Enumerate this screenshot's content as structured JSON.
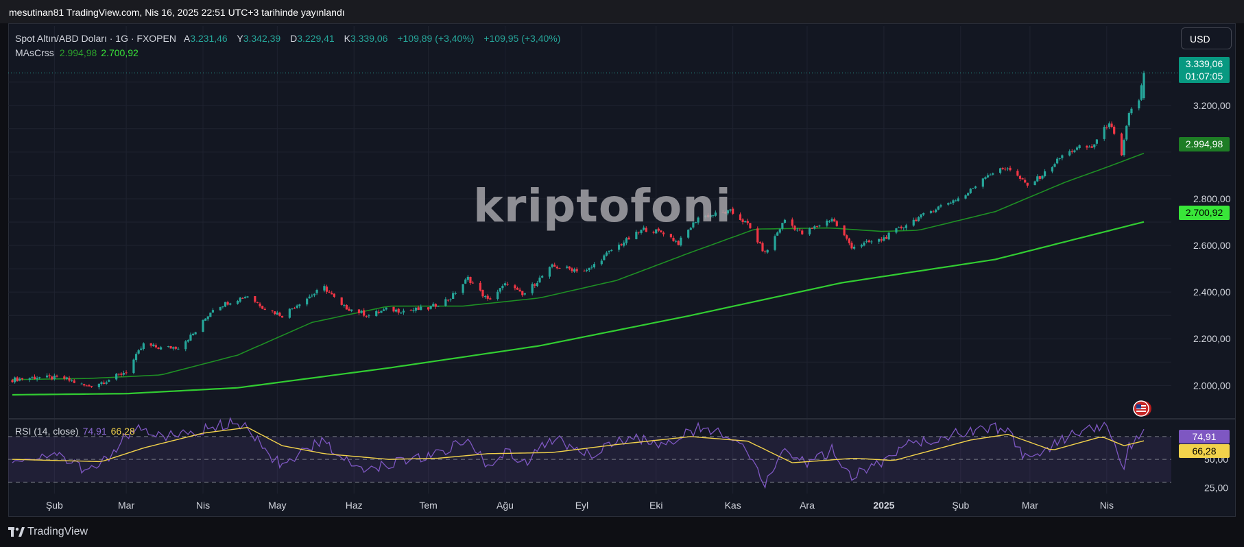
{
  "header": {
    "publish_line": "mesutinan81 TradingView.com, Nis 16, 2025 22:51 UTC+3 tarihinde yayınlandı"
  },
  "legend": {
    "symbol": "Spot Altın/ABD Doları · 1G · FXOPEN",
    "open_key": "A",
    "open": "3.231,46",
    "high_key": "Y",
    "high": "3.342,39",
    "low_key": "D",
    "low": "3.229,41",
    "close_key": "K",
    "close": "3.339,06",
    "change1": "+109,89 (+3,40%)",
    "change2": "+109,95 (+3,40%)",
    "ma_name": "MAsCrss",
    "ma_fast": "2.994,98",
    "ma_slow": "2.700,92"
  },
  "rsi_legend": {
    "name": "RSI (14, close)",
    "rsi": "74,91",
    "ma": "66,28"
  },
  "currency": "USD",
  "tags": {
    "last_price": "3.339,06",
    "countdown": "01:07:05",
    "ma_fast": "2.994,98",
    "ma_slow": "2.700,92",
    "rsi": "74,91",
    "rsi_ma": "66,28"
  },
  "watermark": "kriptofoni",
  "footer": {
    "brand": "TradingView"
  },
  "colors": {
    "up": "#26a69a",
    "down": "#f23645",
    "ma_fast": "#1e8f24",
    "ma_slow": "#32cd32",
    "rsi": "#7e57c2",
    "rsi_ma": "#f2d24b",
    "background": "#131722",
    "grid": "#1f2330"
  },
  "icons": {
    "flag": "us-flag-icon",
    "logo": "tradingview-logo-icon"
  },
  "chart_data": {
    "type": "candlestick",
    "title": "Spot Altın/ABD Doları · 1G · FXOPEN",
    "x_range": [
      "2024-01-15",
      "2025-04-16"
    ],
    "y_ticks": [
      "2.000,00",
      "2.200,00",
      "2.400,00",
      "2.600,00",
      "2.800,00",
      "3.200,00"
    ],
    "y_tick_values": [
      2000,
      2200,
      2400,
      2600,
      2800,
      3200
    ],
    "ylim": [
      1860,
      3540
    ],
    "x_ticks": [
      {
        "label": "Şub",
        "date": "2024-02-01"
      },
      {
        "label": "Mar",
        "date": "2024-03-01"
      },
      {
        "label": "Nis",
        "date": "2024-04-01"
      },
      {
        "label": "May",
        "date": "2024-05-01"
      },
      {
        "label": "Haz",
        "date": "2024-06-01"
      },
      {
        "label": "Tem",
        "date": "2024-07-01"
      },
      {
        "label": "Ağu",
        "date": "2024-08-01"
      },
      {
        "label": "Eyl",
        "date": "2024-09-01"
      },
      {
        "label": "Eki",
        "date": "2024-10-01"
      },
      {
        "label": "Kas",
        "date": "2024-11-01"
      },
      {
        "label": "Ara",
        "date": "2024-12-01"
      },
      {
        "label": "2025",
        "date": "2025-01-01"
      },
      {
        "label": "Şub",
        "date": "2025-02-01"
      },
      {
        "label": "Mar",
        "date": "2025-03-01"
      },
      {
        "label": "Nis",
        "date": "2025-04-01"
      }
    ],
    "price_path": [
      [
        "2024-01-15",
        2025
      ],
      [
        "2024-01-25",
        2035
      ],
      [
        "2024-02-05",
        2030
      ],
      [
        "2024-02-14",
        1995
      ],
      [
        "2024-02-22",
        2020
      ],
      [
        "2024-03-01",
        2060
      ],
      [
        "2024-03-08",
        2175
      ],
      [
        "2024-03-15",
        2160
      ],
      [
        "2024-03-22",
        2165
      ],
      [
        "2024-03-29",
        2230
      ],
      [
        "2024-04-05",
        2330
      ],
      [
        "2024-04-12",
        2360
      ],
      [
        "2024-04-19",
        2385
      ],
      [
        "2024-04-26",
        2330
      ],
      [
        "2024-05-03",
        2300
      ],
      [
        "2024-05-10",
        2355
      ],
      [
        "2024-05-20",
        2420
      ],
      [
        "2024-05-27",
        2340
      ],
      [
        "2024-06-07",
        2300
      ],
      [
        "2024-06-14",
        2325
      ],
      [
        "2024-06-21",
        2320
      ],
      [
        "2024-07-01",
        2330
      ],
      [
        "2024-07-10",
        2375
      ],
      [
        "2024-07-17",
        2460
      ],
      [
        "2024-07-25",
        2365
      ],
      [
        "2024-08-02",
        2440
      ],
      [
        "2024-08-08",
        2385
      ],
      [
        "2024-08-20",
        2510
      ],
      [
        "2024-09-03",
        2490
      ],
      [
        "2024-09-13",
        2580
      ],
      [
        "2024-09-26",
        2670
      ],
      [
        "2024-10-04",
        2655
      ],
      [
        "2024-10-10",
        2610
      ],
      [
        "2024-10-18",
        2720
      ],
      [
        "2024-10-31",
        2745
      ],
      [
        "2024-11-07",
        2690
      ],
      [
        "2024-11-14",
        2565
      ],
      [
        "2024-11-22",
        2710
      ],
      [
        "2024-11-29",
        2650
      ],
      [
        "2024-12-11",
        2715
      ],
      [
        "2024-12-19",
        2595
      ],
      [
        "2024-12-31",
        2625
      ],
      [
        "2025-01-10",
        2690
      ],
      [
        "2025-01-24",
        2770
      ],
      [
        "2025-02-03",
        2815
      ],
      [
        "2025-02-11",
        2900
      ],
      [
        "2025-02-20",
        2935
      ],
      [
        "2025-02-28",
        2855
      ],
      [
        "2025-03-07",
        2910
      ],
      [
        "2025-03-14",
        2985
      ],
      [
        "2025-03-21",
        3020
      ],
      [
        "2025-03-26",
        3020
      ],
      [
        "2025-04-02",
        3130
      ],
      [
        "2025-04-07",
        2980
      ],
      [
        "2025-04-10",
        3170
      ],
      [
        "2025-04-14",
        3225
      ],
      [
        "2025-04-16",
        3339
      ]
    ],
    "series": [
      {
        "name": "MAsCrss 50",
        "color": "#1e8f24",
        "points": [
          [
            "2024-01-15",
            2025
          ],
          [
            "2024-02-15",
            2030
          ],
          [
            "2024-03-15",
            2045
          ],
          [
            "2024-04-15",
            2130
          ],
          [
            "2024-05-15",
            2270
          ],
          [
            "2024-06-15",
            2340
          ],
          [
            "2024-07-15",
            2340
          ],
          [
            "2024-08-15",
            2375
          ],
          [
            "2024-09-15",
            2450
          ],
          [
            "2024-10-15",
            2570
          ],
          [
            "2024-11-10",
            2670
          ],
          [
            "2024-12-10",
            2675
          ],
          [
            "2024-12-31",
            2660
          ],
          [
            "2025-01-15",
            2665
          ],
          [
            "2025-02-15",
            2745
          ],
          [
            "2025-03-15",
            2870
          ],
          [
            "2025-04-01",
            2935
          ],
          [
            "2025-04-16",
            2995
          ]
        ]
      },
      {
        "name": "MAsCrss 200",
        "color": "#32cd32",
        "points": [
          [
            "2024-01-15",
            1960
          ],
          [
            "2024-03-01",
            1965
          ],
          [
            "2024-04-15",
            1990
          ],
          [
            "2024-06-15",
            2075
          ],
          [
            "2024-08-15",
            2170
          ],
          [
            "2024-10-15",
            2300
          ],
          [
            "2024-12-15",
            2440
          ],
          [
            "2025-02-15",
            2540
          ],
          [
            "2025-04-16",
            2701
          ]
        ]
      }
    ],
    "last_close": 3339.06,
    "ma_fast_last": 2994.98,
    "ma_slow_last": 2700.92
  },
  "rsi_data": {
    "type": "line",
    "y_ticks": [
      "50,00",
      "25,00"
    ],
    "y_tick_values": [
      50,
      25
    ],
    "ylim": [
      20,
      85
    ],
    "band": [
      30,
      70
    ],
    "rsi_path": [
      [
        "2024-01-15",
        52
      ],
      [
        "2024-02-05",
        52
      ],
      [
        "2024-02-14",
        38
      ],
      [
        "2024-02-22",
        50
      ],
      [
        "2024-03-04",
        78
      ],
      [
        "2024-03-15",
        70
      ],
      [
        "2024-03-29",
        74
      ],
      [
        "2024-04-12",
        82
      ],
      [
        "2024-04-19",
        80
      ],
      [
        "2024-04-26",
        55
      ],
      [
        "2024-05-03",
        45
      ],
      [
        "2024-05-20",
        68
      ],
      [
        "2024-05-27",
        50
      ],
      [
        "2024-06-07",
        42
      ],
      [
        "2024-06-21",
        50
      ],
      [
        "2024-07-05",
        55
      ],
      [
        "2024-07-17",
        68
      ],
      [
        "2024-07-25",
        45
      ],
      [
        "2024-08-02",
        60
      ],
      [
        "2024-08-08",
        45
      ],
      [
        "2024-08-20",
        68
      ],
      [
        "2024-09-06",
        55
      ],
      [
        "2024-09-20",
        70
      ],
      [
        "2024-10-04",
        63
      ],
      [
        "2024-10-18",
        77
      ],
      [
        "2024-10-31",
        72
      ],
      [
        "2024-11-07",
        55
      ],
      [
        "2024-11-14",
        28
      ],
      [
        "2024-11-22",
        60
      ],
      [
        "2024-12-02",
        45
      ],
      [
        "2024-12-11",
        58
      ],
      [
        "2024-12-19",
        36
      ],
      [
        "2025-01-03",
        50
      ],
      [
        "2025-01-10",
        62
      ],
      [
        "2025-01-24",
        70
      ],
      [
        "2025-02-11",
        78
      ],
      [
        "2025-02-20",
        76
      ],
      [
        "2025-02-28",
        48
      ],
      [
        "2025-03-07",
        58
      ],
      [
        "2025-03-21",
        75
      ],
      [
        "2025-04-02",
        78
      ],
      [
        "2025-04-08",
        38
      ],
      [
        "2025-04-10",
        62
      ],
      [
        "2025-04-16",
        74.91
      ]
    ],
    "rsi_ma_path": [
      [
        "2024-01-15",
        50
      ],
      [
        "2024-02-20",
        48
      ],
      [
        "2024-03-08",
        60
      ],
      [
        "2024-04-01",
        73
      ],
      [
        "2024-04-19",
        78
      ],
      [
        "2024-05-03",
        62
      ],
      [
        "2024-05-20",
        55
      ],
      [
        "2024-06-15",
        50
      ],
      [
        "2024-07-05",
        51
      ],
      [
        "2024-07-25",
        55
      ],
      [
        "2024-08-20",
        56
      ],
      [
        "2024-09-15",
        63
      ],
      [
        "2024-10-15",
        70
      ],
      [
        "2024-11-07",
        66
      ],
      [
        "2024-11-25",
        47
      ],
      [
        "2024-12-20",
        51
      ],
      [
        "2025-01-05",
        49
      ],
      [
        "2025-02-05",
        67
      ],
      [
        "2025-02-20",
        72
      ],
      [
        "2025-03-10",
        58
      ],
      [
        "2025-03-30",
        70
      ],
      [
        "2025-04-08",
        62
      ],
      [
        "2025-04-16",
        66.28
      ]
    ]
  }
}
